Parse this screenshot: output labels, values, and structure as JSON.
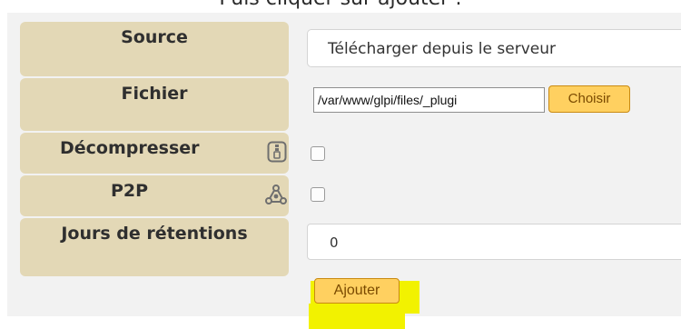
{
  "caption": "Puis cliquer sur ajouter :",
  "form": {
    "source": {
      "label": "Source",
      "selected": "Télécharger depuis le serveur"
    },
    "fichier": {
      "label": "Fichier",
      "value": "/var/www/glpi/files/_plugi",
      "button": "Choisir"
    },
    "decompresser": {
      "label": "Décompresser",
      "icon": "zip-file-icon",
      "checked": false
    },
    "p2p": {
      "label": "P2P",
      "icon": "p2p-network-icon",
      "checked": false
    },
    "jours": {
      "label": "Jours de rétentions",
      "value": "0"
    },
    "submit_label": "Ajouter"
  },
  "colors": {
    "label_bg": "#e3d8b6",
    "button_bg": "#ffd060",
    "highlight": "#f2f200"
  }
}
